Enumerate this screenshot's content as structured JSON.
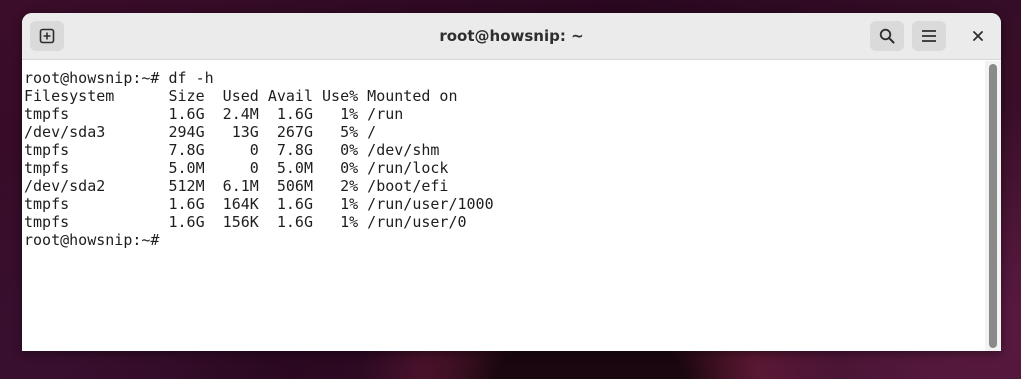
{
  "window": {
    "title": "root@howsnip: ~"
  },
  "titlebar": {
    "new_tab_icon": "new-tab-icon",
    "search_icon": "search-icon",
    "menu_icon": "hamburger-menu-icon",
    "close_icon": "close-icon"
  },
  "terminal": {
    "lines": [
      "root@howsnip:~# df -h",
      "Filesystem      Size  Used Avail Use% Mounted on",
      "tmpfs           1.6G  2.4M  1.6G   1% /run",
      "/dev/sda3       294G   13G  267G   5% /",
      "tmpfs           7.8G     0  7.8G   0% /dev/shm",
      "tmpfs           5.0M     0  5.0M   0% /run/lock",
      "/dev/sda2       512M  6.1M  506M   2% /boot/efi",
      "tmpfs           1.6G  164K  1.6G   1% /run/user/1000",
      "tmpfs           1.6G  156K  1.6G   1% /run/user/0",
      "root@howsnip:~# "
    ]
  },
  "colors": {
    "terminal_text": "#1e1e1e",
    "terminal_bg": "#ffffff",
    "titlebar_bg": "#ebebeb"
  }
}
